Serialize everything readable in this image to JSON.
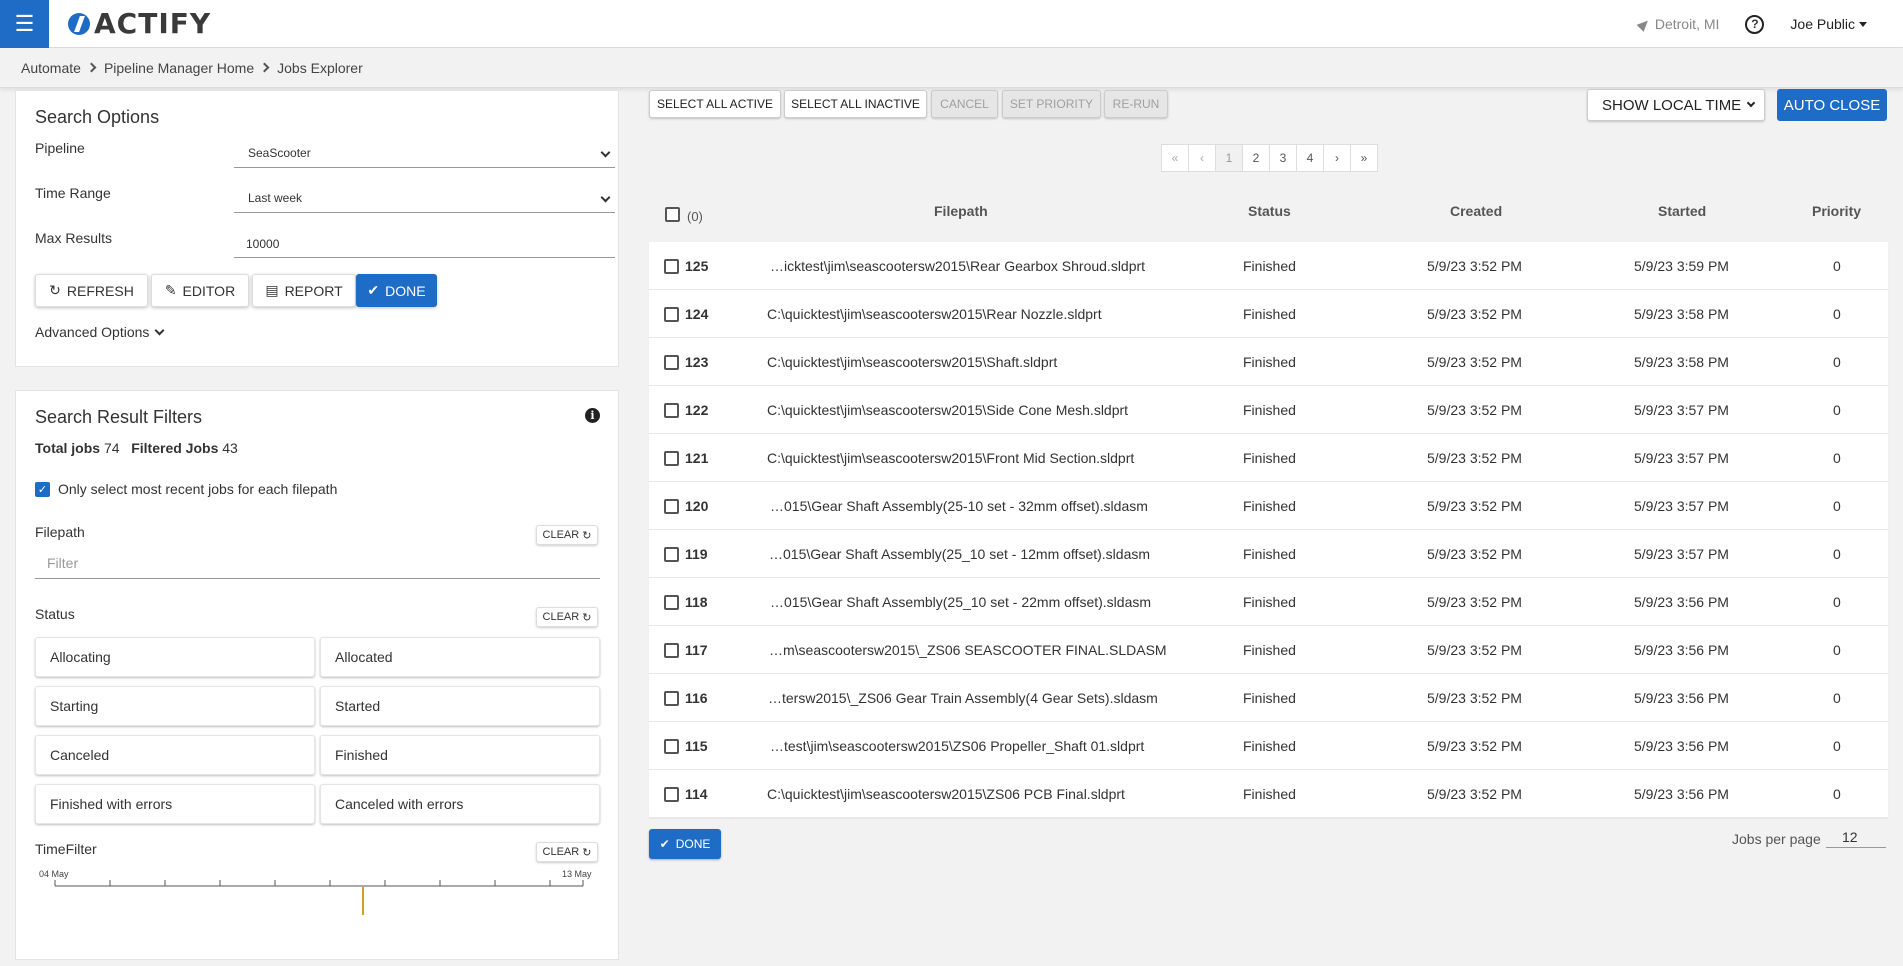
{
  "header": {
    "logo_text": "ACTIFY",
    "location": "Detroit, MI",
    "user": "Joe Public",
    "menu_icon": "hamburger-icon",
    "help_icon": "question-circle-icon"
  },
  "breadcrumb": [
    "Automate",
    "Pipeline Manager Home",
    "Jobs Explorer"
  ],
  "search_options": {
    "title": "Search Options",
    "pipeline_label": "Pipeline",
    "pipeline_value": "SeaScooter",
    "time_range_label": "Time Range",
    "time_range_value": "Last week",
    "max_results_label": "Max Results",
    "max_results_value": "10000",
    "refresh_label": "REFRESH",
    "editor_label": "EDITOR",
    "report_label": "REPORT",
    "done_label": "DONE",
    "advanced_label": "Advanced Options"
  },
  "filters": {
    "title": "Search Result Filters",
    "total_jobs_label": "Total jobs",
    "total_jobs": "74",
    "filtered_jobs_label": "Filtered Jobs",
    "filtered_jobs": "43",
    "recent_only_label": "Only select most recent jobs for each filepath",
    "recent_only_checked": true,
    "filepath_label": "Filepath",
    "filepath_placeholder": "Filter",
    "clear_label": "CLEAR",
    "status_label": "Status",
    "statuses": [
      "Allocating",
      "Allocated",
      "Starting",
      "Started",
      "Canceled",
      "Finished",
      "Finished with errors",
      "Canceled with errors"
    ],
    "timefilter_label": "TimeFilter",
    "time_start": "04 May",
    "time_end": "13 May"
  },
  "toolbar": {
    "select_all_active": "SELECT ALL ACTIVE",
    "select_all_inactive": "SELECT ALL INACTIVE",
    "cancel": "CANCEL",
    "set_priority": "SET PRIORITY",
    "rerun": "RE-RUN",
    "time_mode": "SHOW LOCAL TIME",
    "auto_close": "AUTO CLOSE"
  },
  "pagination": {
    "first": "«",
    "prev": "‹",
    "pages": [
      "1",
      "2",
      "3",
      "4"
    ],
    "next": "›",
    "last": "»",
    "current": "1"
  },
  "table": {
    "selected_count": "(0)",
    "columns": [
      "Filepath",
      "Status",
      "Created",
      "Started",
      "Priority"
    ],
    "rows": [
      {
        "id": "125",
        "filepath": "…icktest\\jim\\seascootersw2015\\Rear Gearbox Shroud.sldprt",
        "status": "Finished",
        "created": "5/9/23 3:52 PM",
        "started": "5/9/23 3:59 PM",
        "priority": "0"
      },
      {
        "id": "124",
        "filepath": "C:\\quicktest\\jim\\seascootersw2015\\Rear Nozzle.sldprt",
        "status": "Finished",
        "created": "5/9/23 3:52 PM",
        "started": "5/9/23 3:58 PM",
        "priority": "0"
      },
      {
        "id": "123",
        "filepath": "C:\\quicktest\\jim\\seascootersw2015\\Shaft.sldprt",
        "status": "Finished",
        "created": "5/9/23 3:52 PM",
        "started": "5/9/23 3:58 PM",
        "priority": "0"
      },
      {
        "id": "122",
        "filepath": "C:\\quicktest\\jim\\seascootersw2015\\Side Cone Mesh.sldprt",
        "status": "Finished",
        "created": "5/9/23 3:52 PM",
        "started": "5/9/23 3:57 PM",
        "priority": "0"
      },
      {
        "id": "121",
        "filepath": "C:\\quicktest\\jim\\seascootersw2015\\Front Mid Section.sldprt",
        "status": "Finished",
        "created": "5/9/23 3:52 PM",
        "started": "5/9/23 3:57 PM",
        "priority": "0"
      },
      {
        "id": "120",
        "filepath": "…015\\Gear Shaft Assembly(25-10 set - 32mm offset).sldasm",
        "status": "Finished",
        "created": "5/9/23 3:52 PM",
        "started": "5/9/23 3:57 PM",
        "priority": "0"
      },
      {
        "id": "119",
        "filepath": "…015\\Gear Shaft Assembly(25_10 set - 12mm offset).sldasm",
        "status": "Finished",
        "created": "5/9/23 3:52 PM",
        "started": "5/9/23 3:57 PM",
        "priority": "0"
      },
      {
        "id": "118",
        "filepath": "…015\\Gear Shaft Assembly(25_10 set - 22mm offset).sldasm",
        "status": "Finished",
        "created": "5/9/23 3:52 PM",
        "started": "5/9/23 3:56 PM",
        "priority": "0"
      },
      {
        "id": "117",
        "filepath": "…m\\seascootersw2015\\_ZS06 SEASCOOTER FINAL.SLDASM",
        "status": "Finished",
        "created": "5/9/23 3:52 PM",
        "started": "5/9/23 3:56 PM",
        "priority": "0"
      },
      {
        "id": "116",
        "filepath": "…tersw2015\\_ZS06 Gear Train Assembly(4 Gear Sets).sldasm",
        "status": "Finished",
        "created": "5/9/23 3:52 PM",
        "started": "5/9/23 3:56 PM",
        "priority": "0"
      },
      {
        "id": "115",
        "filepath": "…test\\jim\\seascootersw2015\\ZS06 Propeller_Shaft 01.sldprt",
        "status": "Finished",
        "created": "5/9/23 3:52 PM",
        "started": "5/9/23 3:56 PM",
        "priority": "0"
      },
      {
        "id": "114",
        "filepath": "C:\\quicktest\\jim\\seascootersw2015\\ZS06 PCB Final.sldprt",
        "status": "Finished",
        "created": "5/9/23 3:52 PM",
        "started": "5/9/23 3:56 PM",
        "priority": "0"
      }
    ]
  },
  "footer": {
    "done_label": "DONE",
    "jobs_per_page_label": "Jobs per page",
    "jobs_per_page": "12"
  },
  "colors": {
    "accent": "#1f6cc6",
    "timefilter_marker": "#c9a227"
  }
}
